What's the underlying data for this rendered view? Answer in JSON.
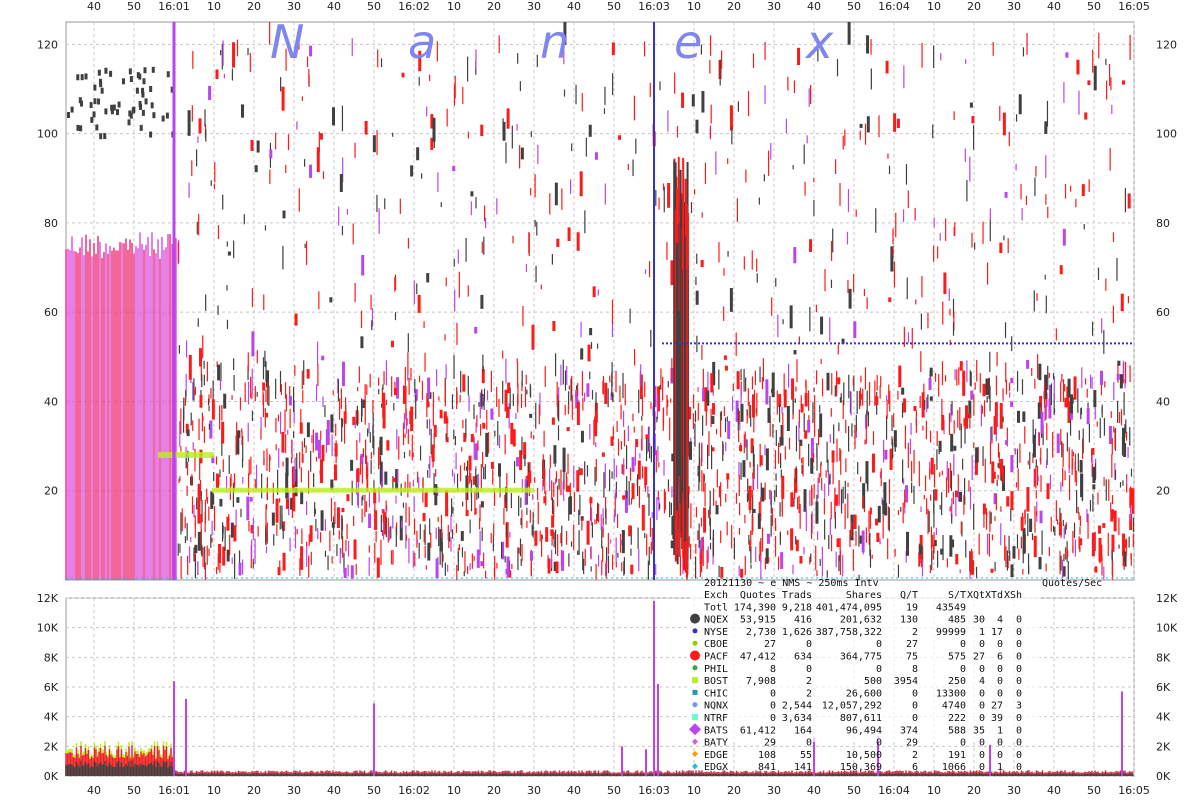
{
  "watermark": [
    "N",
    "a",
    "n",
    "e",
    "x"
  ],
  "chart_data": [
    {
      "type": "scatter",
      "title": "",
      "xlabel": "",
      "ylabel": "",
      "x_time_range": [
        "16:00:33",
        "16:05:00"
      ],
      "x_ticks": [
        "40",
        "50",
        "16:01",
        "10",
        "20",
        "30",
        "40",
        "50",
        "16:02",
        "10",
        "20",
        "30",
        "40",
        "50",
        "16:03",
        "10",
        "20",
        "30",
        "40",
        "50",
        "16:04",
        "10",
        "20",
        "30",
        "40",
        "50",
        "16:05"
      ],
      "ylim": [
        0,
        125
      ],
      "y_ticks": [
        20,
        40,
        60,
        80,
        100,
        120
      ],
      "grid": true,
      "series_colors": {
        "NQEX": "#404040",
        "PACF": "#ff1a1a",
        "BATS": "#bb44ee",
        "NYSE": "#3333cc",
        "BOST": "#bbee22",
        "EDGX": "#22bbdd",
        "EDGE": "#ff9900"
      },
      "note_levels": {
        "NYSE_line": 53,
        "BOST_band_1": 20,
        "BOST_band_2": 28
      }
    },
    {
      "type": "area",
      "xlabel": "",
      "ylabel": "Quotes/Sec",
      "ylim": [
        0,
        12000
      ],
      "y_ticks": [
        "0K",
        "2K",
        "4K",
        "6K",
        "8K",
        "10K",
        "12K"
      ],
      "x_ticks": [
        "40",
        "50",
        "16:01",
        "10",
        "20",
        "30",
        "40",
        "50",
        "16:02",
        "10",
        "20",
        "30",
        "40",
        "50",
        "16:03",
        "10",
        "20",
        "30",
        "40",
        "50",
        "16:04",
        "10",
        "20",
        "30",
        "40",
        "50",
        "16:05"
      ],
      "spikes": [
        {
          "t": "16:01:00",
          "v": 6400
        },
        {
          "t": "16:01:03",
          "v": 5200
        },
        {
          "t": "16:01:50",
          "v": 4900
        },
        {
          "t": "16:02:52",
          "v": 2000
        },
        {
          "t": "16:02:58",
          "v": 1800
        },
        {
          "t": "16:03:00",
          "v": 11800
        },
        {
          "t": "16:03:01",
          "v": 6200
        },
        {
          "t": "16:03:40",
          "v": 2600
        },
        {
          "t": "16:03:56",
          "v": 2700
        },
        {
          "t": "16:04:24",
          "v": 2100
        },
        {
          "t": "16:04:57",
          "v": 5700
        }
      ],
      "baseline_pre": 1600,
      "baseline_post": 300
    }
  ],
  "table": {
    "header_line": "20121130 ~ e_NMS ~ 250ms Intv",
    "units_label": "Quotes/Sec",
    "columns": [
      "Exch",
      "Quotes",
      "Trads",
      "Shares",
      "Q/T",
      "S/T",
      "XQt",
      "XTd",
      "XSh"
    ],
    "total": {
      "name": "Totl",
      "quotes": "174,390",
      "trads": "9,218",
      "shares": "401,474,095",
      "qt": "19",
      "st": "43549",
      "xqt": "",
      "xtd": "",
      "xsh": ""
    },
    "rows": [
      {
        "name": "NQEX",
        "quotes": "53,915",
        "trads": "416",
        "shares": "201,632",
        "qt": "130",
        "st": "485",
        "xqt": "30",
        "xtd": "4",
        "xsh": "0",
        "color": "#404040",
        "marker": "circle",
        "size": 5
      },
      {
        "name": "NYSE",
        "quotes": "2,730",
        "trads": "1,626",
        "shares": "387,758,322",
        "qt": "2",
        "st": "99999",
        "xqt": "1",
        "xtd": "17",
        "xsh": "0",
        "color": "#3333cc",
        "marker": "circle",
        "size": 2.5
      },
      {
        "name": "CBOE",
        "quotes": "27",
        "trads": "0",
        "shares": "0",
        "qt": "27",
        "st": "0",
        "xqt": "0",
        "xtd": "0",
        "xsh": "0",
        "color": "#99cc00",
        "marker": "circle",
        "size": 2.5
      },
      {
        "name": "PACF",
        "quotes": "47,412",
        "trads": "634",
        "shares": "364,775",
        "qt": "75",
        "st": "575",
        "xqt": "27",
        "xtd": "6",
        "xsh": "0",
        "color": "#ff1a1a",
        "marker": "circle",
        "size": 5
      },
      {
        "name": "PHIL",
        "quotes": "8",
        "trads": "0",
        "shares": "0",
        "qt": "8",
        "st": "0",
        "xqt": "0",
        "xtd": "0",
        "xsh": "0",
        "color": "#33aa33",
        "marker": "circle",
        "size": 2.5
      },
      {
        "name": "BOST",
        "quotes": "7,908",
        "trads": "2",
        "shares": "500",
        "qt": "3954",
        "st": "250",
        "xqt": "4",
        "xtd": "0",
        "xsh": "0",
        "color": "#bbee22",
        "marker": "square",
        "size": 3
      },
      {
        "name": "CHIC",
        "quotes": "0",
        "trads": "2",
        "shares": "26,600",
        "qt": "0",
        "st": "13300",
        "xqt": "0",
        "xtd": "0",
        "xsh": "0",
        "color": "#2299aa",
        "marker": "square",
        "size": 2.5
      },
      {
        "name": "NQNX",
        "quotes": "0",
        "trads": "2,544",
        "shares": "12,057,292",
        "qt": "0",
        "st": "4740",
        "xqt": "0",
        "xtd": "27",
        "xsh": "3",
        "color": "#6699ff",
        "marker": "circle",
        "size": 2.5
      },
      {
        "name": "NTRF",
        "quotes": "0",
        "trads": "3,634",
        "shares": "807,611",
        "qt": "0",
        "st": "222",
        "xqt": "0",
        "xtd": "39",
        "xsh": "0",
        "color": "#66ffcc",
        "marker": "square",
        "size": 3
      },
      {
        "name": "BATS",
        "quotes": "61,412",
        "trads": "164",
        "shares": "96,494",
        "qt": "374",
        "st": "588",
        "xqt": "35",
        "xtd": "1",
        "xsh": "0",
        "color": "#bb44ee",
        "marker": "diamond",
        "size": 6
      },
      {
        "name": "BATY",
        "quotes": "29",
        "trads": "0",
        "shares": "0",
        "qt": "29",
        "st": "0",
        "xqt": "0",
        "xtd": "0",
        "xsh": "0",
        "color": "#cc66cc",
        "marker": "diamond",
        "size": 3
      },
      {
        "name": "EDGE",
        "quotes": "108",
        "trads": "55",
        "shares": "10,500",
        "qt": "2",
        "st": "191",
        "xqt": "0",
        "xtd": "0",
        "xsh": "0",
        "color": "#ff9900",
        "marker": "diamond",
        "size": 3
      },
      {
        "name": "EDGX",
        "quotes": "841",
        "trads": "141",
        "shares": "150,369",
        "qt": "6",
        "st": "1066",
        "xqt": "0",
        "xtd": "1",
        "xsh": "0",
        "color": "#22bbdd",
        "marker": "diamond",
        "size": 3
      }
    ]
  }
}
